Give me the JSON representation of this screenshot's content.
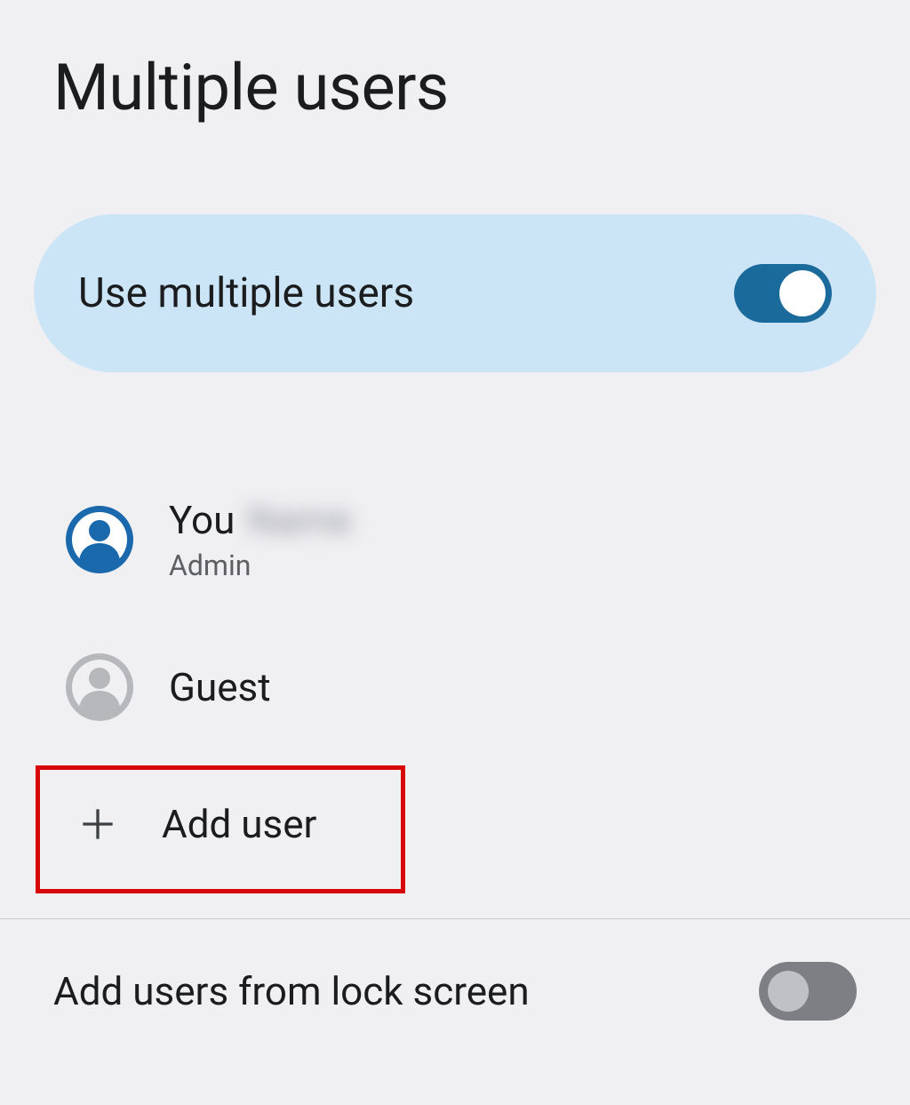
{
  "page": {
    "title": "Multiple users"
  },
  "toggle_card": {
    "label": "Use multiple users",
    "enabled": true
  },
  "users": [
    {
      "title": "You",
      "redacted_suffix": "Name",
      "subtitle": "Admin",
      "avatar_color": "#1a69ac"
    },
    {
      "title": "Guest",
      "subtitle": "",
      "avatar_color": "#b6b8bc"
    }
  ],
  "add_user": {
    "label": "Add user"
  },
  "lock_screen": {
    "label": "Add users from lock screen",
    "enabled": false
  },
  "colors": {
    "card_bg": "#cce5f6",
    "accent": "#1b6a9c",
    "highlight": "#d80707"
  }
}
